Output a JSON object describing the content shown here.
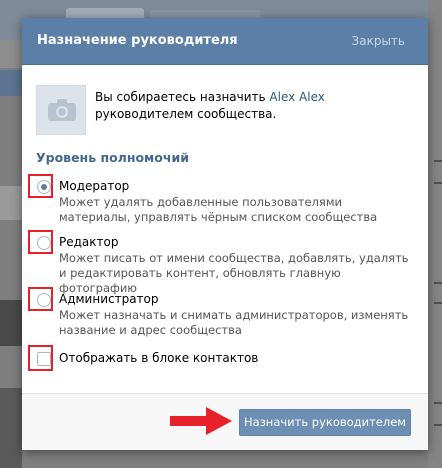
{
  "dialog": {
    "title": "Назначение руководителя",
    "close_label": "Закрыть"
  },
  "notice": {
    "text_before": "Вы собираетесь назначить ",
    "user_name": "Alex Alex",
    "text_after": " руководителем сообщества."
  },
  "permissions": {
    "section_title": "Уровень полномочий",
    "options": [
      {
        "label": "Модератор",
        "description": "Может удалять добавленные пользователями материалы, управлять чёрным списком сообщества",
        "selected": true
      },
      {
        "label": "Редактор",
        "description": "Может писать от имени сообщества, добавлять, удалять и редактировать контент, обновлять главную фотографию",
        "selected": false
      },
      {
        "label": "Администратор",
        "description": "Может назначать и снимать администраторов, изменять название и адрес сообщества",
        "selected": false
      }
    ],
    "contacts_checkbox": {
      "label": "Отображать в блоке контактов",
      "checked": false
    }
  },
  "footer": {
    "submit_label": "Назначить руководителем"
  },
  "colors": {
    "header_bg": "#5b7fa6",
    "accent": "#45688e",
    "link": "#2b587a",
    "annotation_red": "#e8202a",
    "button_bg": "#6d8fb3"
  },
  "icons": [
    "camera-icon",
    "radio-icon",
    "checkbox-icon",
    "arrow-right-icon"
  ]
}
